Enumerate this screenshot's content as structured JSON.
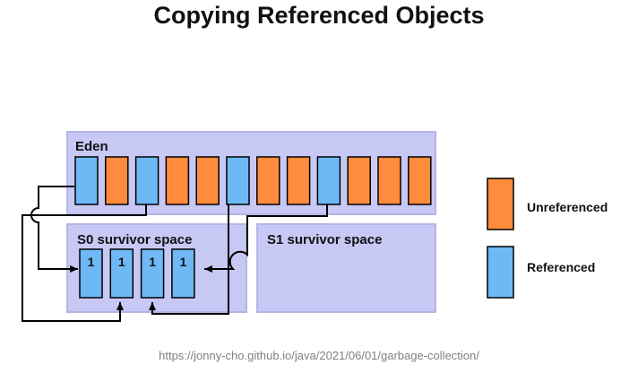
{
  "title": "Copying Referenced Objects",
  "caption": "https://jonny-cho.github.io/java/2021/06/01/garbage-collection/",
  "colors": {
    "unreferenced": "#FF8C3C",
    "referenced": "#6EB9F5",
    "region_fill": "#C8C8F5",
    "region_border": "#B4B4E6"
  },
  "regions": {
    "eden": "Eden",
    "s0": "S0 survivor space",
    "s1": "S1 survivor space"
  },
  "eden_objects": [
    "referenced",
    "unreferenced",
    "referenced",
    "unreferenced",
    "unreferenced",
    "referenced",
    "unreferenced",
    "unreferenced",
    "referenced",
    "unreferenced",
    "unreferenced",
    "unreferenced"
  ],
  "s0_objects": [
    "1",
    "1",
    "1",
    "1"
  ],
  "legend": [
    {
      "label": "Unreferenced",
      "status": "unreferenced"
    },
    {
      "label": "Referenced",
      "status": "referenced"
    }
  ]
}
